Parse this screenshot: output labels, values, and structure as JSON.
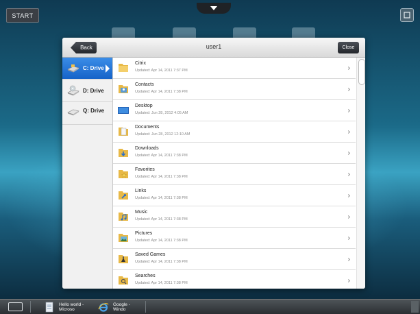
{
  "desktop": {
    "start_label": "START"
  },
  "dialog": {
    "back_label": "Back",
    "title": "user1",
    "close_label": "Close"
  },
  "drives": [
    {
      "label": "C: Drive",
      "icon": "drive-c-icon",
      "selected": true
    },
    {
      "label": "D: Drive",
      "icon": "dvd-drive-icon",
      "selected": false
    },
    {
      "label": "Q: Drive",
      "icon": "network-drive-icon",
      "selected": false
    }
  ],
  "files": [
    {
      "name": "Citrix",
      "updated": "Updated: Apr 14, 2011 7:37 PM",
      "icon": "folder-icon"
    },
    {
      "name": "Contacts",
      "updated": "Updated: Apr 14, 2011 7:38 PM",
      "icon": "contacts-folder-icon"
    },
    {
      "name": "Desktop",
      "updated": "Updated: Jun 28, 2012 4:05 AM",
      "icon": "desktop-folder-icon"
    },
    {
      "name": "Documents",
      "updated": "Updated: Jun 28, 2012 12:10 AM",
      "icon": "documents-folder-icon"
    },
    {
      "name": "Downloads",
      "updated": "Updated: Apr 14, 2011 7:38 PM",
      "icon": "downloads-folder-icon"
    },
    {
      "name": "Favorites",
      "updated": "Updated: Apr 14, 2011 7:38 PM",
      "icon": "favorites-folder-icon"
    },
    {
      "name": "Links",
      "updated": "Updated: Apr 14, 2011 7:38 PM",
      "icon": "links-folder-icon"
    },
    {
      "name": "Music",
      "updated": "Updated: Apr 14, 2011 7:38 PM",
      "icon": "music-folder-icon"
    },
    {
      "name": "Pictures",
      "updated": "Updated: Apr 14, 2011 7:38 PM",
      "icon": "pictures-folder-icon"
    },
    {
      "name": "Saved Games",
      "updated": "Updated: Apr 14, 2011 7:38 PM",
      "icon": "saved-games-folder-icon"
    },
    {
      "name": "Searches",
      "updated": "Updated: Apr 14, 2011 7:38 PM",
      "icon": "searches-folder-icon"
    }
  ],
  "taskbar": {
    "items": [
      {
        "label": "Hello world - Microso",
        "icon": "word-document-icon"
      },
      {
        "label": "Google - Windo",
        "icon": "internet-explorer-icon"
      }
    ]
  },
  "colors": {
    "accent": "#1a6fd6",
    "titlebar": "#e4e4e4",
    "folder": "#e8b947"
  }
}
